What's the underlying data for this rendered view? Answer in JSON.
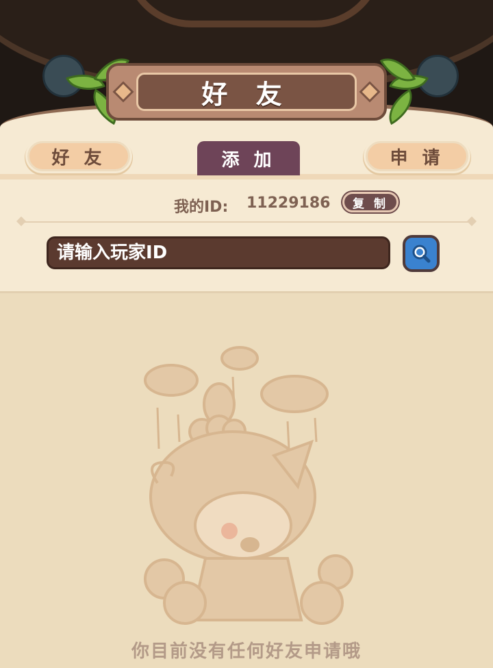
{
  "header": {
    "title": "好 友"
  },
  "tabs": [
    {
      "label": "好 友",
      "active": false
    },
    {
      "label": "添 加",
      "active": true
    },
    {
      "label": "申 请",
      "active": false
    }
  ],
  "my_id": {
    "label": "我的ID:",
    "value": "11229186",
    "copy_button": "复 制"
  },
  "search": {
    "placeholder": "请输入玩家ID",
    "icon": "search-icon"
  },
  "empty_state": {
    "message": "你目前没有任何好友申请哦"
  },
  "colors": {
    "active_tab": "#6e4458",
    "inactive_tab": "#f3cda5",
    "search_button": "#3a82cf",
    "panel_bg": "#f6ead3",
    "content_bg": "#ecdcbd"
  }
}
